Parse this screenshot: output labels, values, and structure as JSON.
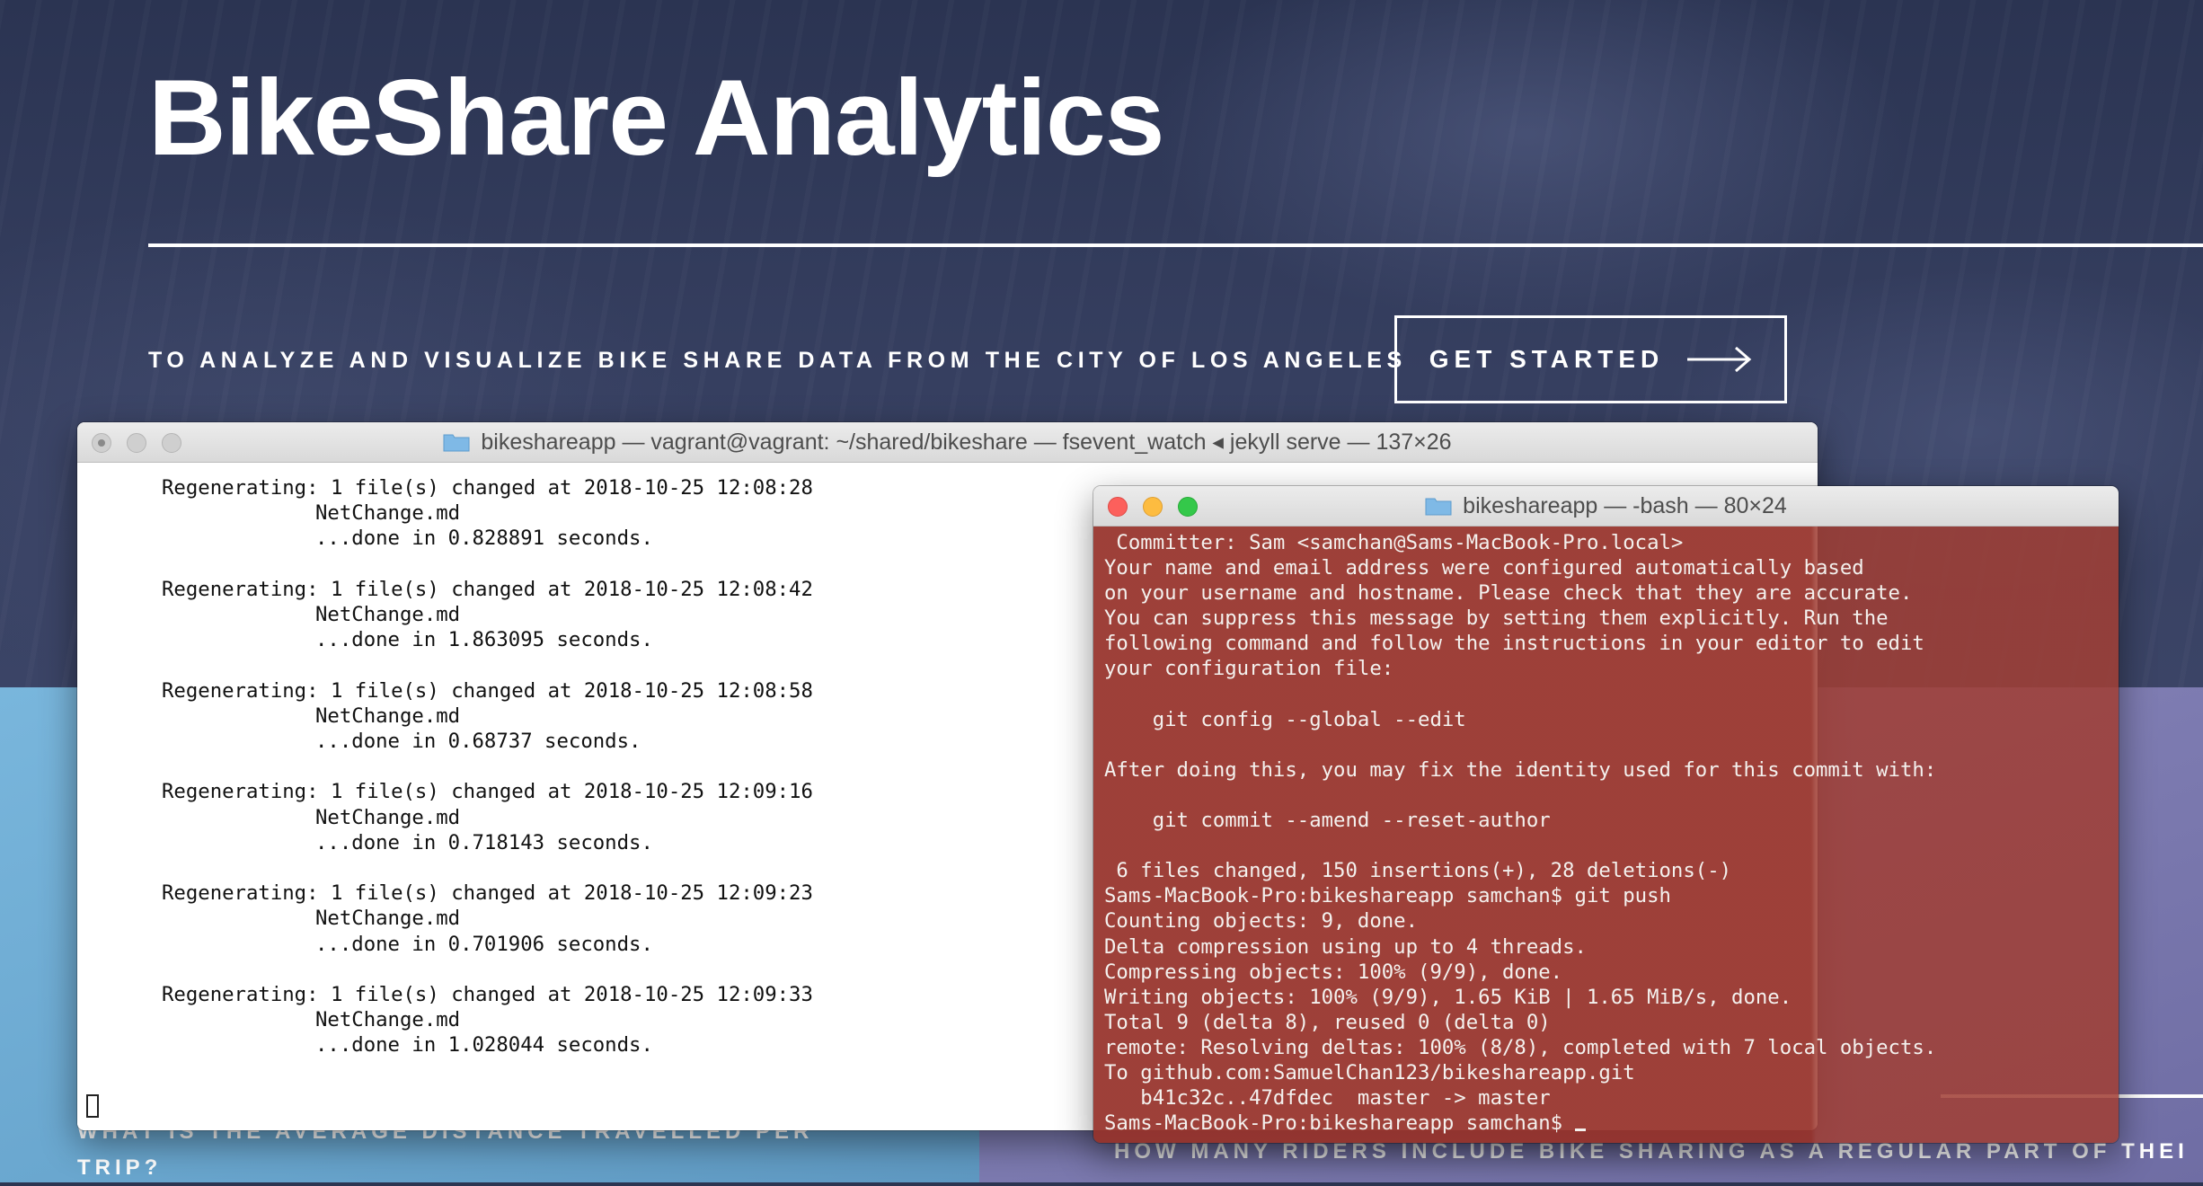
{
  "hero": {
    "title": "BikeShare Analytics",
    "tagline": "TO ANALYZE AND VISUALIZE BIKE SHARE DATA FROM THE CITY OF LOS ANGELES",
    "cta_label": "GET STARTED",
    "cta_icon": "arrow-right-icon"
  },
  "cards": {
    "left_question": "WHAT IS THE AVERAGE DISTANCE TRAVELLED PER TRIP?",
    "right_question": "HOW MANY RIDERS INCLUDE BIKE SHARING AS A REGULAR PART OF THEI"
  },
  "terminal_back": {
    "title": "bikeshareapp — vagrant@vagrant: ~/shared/bikeshare — fsevent_watch ◂ jekyll serve — 137×26",
    "entries": [
      {
        "prefix": "Regenerating:",
        "changed": "1 file(s) changed at 2018-10-25 12:08:28",
        "file": "NetChange.md",
        "done": "...done in 0.828891 seconds."
      },
      {
        "prefix": "Regenerating:",
        "changed": "1 file(s) changed at 2018-10-25 12:08:42",
        "file": "NetChange.md",
        "done": "...done in 1.863095 seconds."
      },
      {
        "prefix": "Regenerating:",
        "changed": "1 file(s) changed at 2018-10-25 12:08:58",
        "file": "NetChange.md",
        "done": "...done in 0.68737 seconds."
      },
      {
        "prefix": "Regenerating:",
        "changed": "1 file(s) changed at 2018-10-25 12:09:16",
        "file": "NetChange.md",
        "done": "...done in 0.718143 seconds."
      },
      {
        "prefix": "Regenerating:",
        "changed": "1 file(s) changed at 2018-10-25 12:09:23",
        "file": "NetChange.md",
        "done": "...done in 0.701906 seconds."
      },
      {
        "prefix": "Regenerating:",
        "changed": "1 file(s) changed at 2018-10-25 12:09:33",
        "file": "NetChange.md",
        "done": "...done in 1.028044 seconds."
      }
    ]
  },
  "terminal_front": {
    "title": "bikeshareapp — -bash — 80×24",
    "lines": [
      " Committer: Sam <samchan@Sams-MacBook-Pro.local>",
      "Your name and email address were configured automatically based",
      "on your username and hostname. Please check that they are accurate.",
      "You can suppress this message by setting them explicitly. Run the",
      "following command and follow the instructions in your editor to edit",
      "your configuration file:",
      "",
      "    git config --global --edit",
      "",
      "After doing this, you may fix the identity used for this commit with:",
      "",
      "    git commit --amend --reset-author",
      "",
      " 6 files changed, 150 insertions(+), 28 deletions(-)",
      "Sams-MacBook-Pro:bikeshareapp samchan$ git push",
      "Counting objects: 9, done.",
      "Delta compression using up to 4 threads.",
      "Compressing objects: 100% (9/9), done.",
      "Writing objects: 100% (9/9), 1.65 KiB | 1.65 MiB/s, done.",
      "Total 9 (delta 8), reused 0 (delta 0)",
      "remote: Resolving deltas: 100% (8/8), completed with 7 local objects.",
      "To github.com:SamuelChan123/bikeshareapp.git",
      "   b41c32c..47dfdec  master -> master"
    ],
    "prompt": "Sams-MacBook-Pro:bikeshareapp samchan$ "
  },
  "colors": {
    "hero_bg": "#2c3551",
    "card_left": "#6aa7cf",
    "card_right": "#7a78ae",
    "terminal_red": "#96322a",
    "close_red": "#fc605c",
    "minimize_yellow": "#fdbc40",
    "zoom_green": "#34c84a"
  }
}
